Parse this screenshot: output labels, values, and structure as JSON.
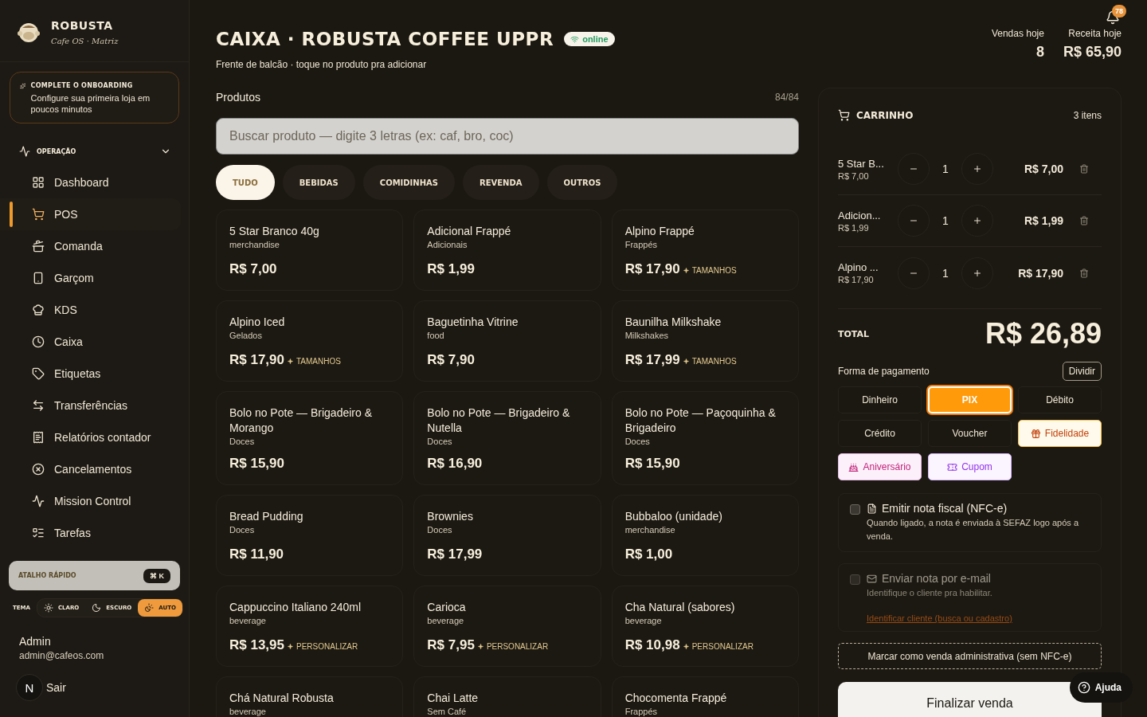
{
  "brand": {
    "name": "ROBUSTA",
    "subtitle": "Cafe OS · Matriz"
  },
  "onboarding": {
    "title": "COMPLETE O ONBOARDING",
    "text": "Configure sua primeira loja em poucos minutos"
  },
  "nav_section": {
    "label": "OPERAÇÃO",
    "expanded": true
  },
  "nav": [
    {
      "label": "Dashboard",
      "selected": false
    },
    {
      "label": "POS",
      "selected": true
    },
    {
      "label": "Comanda",
      "selected": false
    },
    {
      "label": "Garçom",
      "selected": false
    },
    {
      "label": "KDS",
      "selected": false
    },
    {
      "label": "Caixa",
      "selected": false
    },
    {
      "label": "Etiquetas",
      "selected": false
    },
    {
      "label": "Transferências",
      "selected": false
    },
    {
      "label": "Relatórios contador",
      "selected": false
    },
    {
      "label": "Cancelamentos",
      "selected": false
    },
    {
      "label": "Mission Control",
      "selected": false
    },
    {
      "label": "Tarefas",
      "selected": false
    }
  ],
  "quick": {
    "label": "ATALHO RÁPIDO",
    "shortcut": "⌘ K"
  },
  "theme": {
    "label": "TEMA",
    "options": [
      {
        "label": "CLARO",
        "selected": false
      },
      {
        "label": "ESCURO",
        "selected": false
      },
      {
        "label": "AUTO",
        "selected": true
      }
    ]
  },
  "user": {
    "name": "Admin",
    "email": "admin@cafeos.com",
    "logout": "Sair",
    "avatar": "N"
  },
  "header": {
    "title": "CAIXA · ROBUSTA COFFEE UPPR",
    "status": "online",
    "subtitle": "Frente de balcão · toque no produto pra adicionar"
  },
  "stats": [
    {
      "label": "Vendas hoje",
      "value": "8"
    },
    {
      "label": "Receita hoje",
      "value": "R$ 65,90"
    }
  ],
  "notifications": {
    "count": "78"
  },
  "products_header": {
    "title": "Produtos",
    "count": "84/84"
  },
  "search": {
    "placeholder": "Buscar produto — digite 3 letras (ex: caf, bro, coc)"
  },
  "categories": [
    {
      "label": "TUDO",
      "selected": true
    },
    {
      "label": "BEBIDAS",
      "selected": false
    },
    {
      "label": "COMIDINHAS",
      "selected": false
    },
    {
      "label": "REVENDA",
      "selected": false
    },
    {
      "label": "OUTROS",
      "selected": false
    }
  ],
  "products": [
    {
      "name": "5 Star Branco 40g",
      "category": "merchandise",
      "price": "R$ 7,00"
    },
    {
      "name": "Adicional Frappé",
      "category": "Adicionais",
      "price": "R$ 1,99"
    },
    {
      "name": "Alpino Frappé",
      "category": "Frappés",
      "price": "R$ 17,90",
      "extra": "TAMANHOS"
    },
    {
      "name": "Alpino Iced",
      "category": "Gelados",
      "price": "R$ 17,90",
      "extra": "TAMANHOS"
    },
    {
      "name": "Baguetinha Vitrine",
      "category": "food",
      "price": "R$ 7,90"
    },
    {
      "name": "Baunilha Milkshake",
      "category": "Milkshakes",
      "price": "R$ 17,99",
      "extra": "TAMANHOS"
    },
    {
      "name": "Bolo no Pote — Brigadeiro & Morango",
      "category": "Doces",
      "price": "R$ 15,90"
    },
    {
      "name": "Bolo no Pote — Brigadeiro & Nutella",
      "category": "Doces",
      "price": "R$ 16,90"
    },
    {
      "name": "Bolo no Pote — Paçoquinha & Brigadeiro",
      "category": "Doces",
      "price": "R$ 15,90"
    },
    {
      "name": "Bread Pudding",
      "category": "Doces",
      "price": "R$ 11,90"
    },
    {
      "name": "Brownies",
      "category": "Doces",
      "price": "R$ 17,99"
    },
    {
      "name": "Bubbaloo (unidade)",
      "category": "merchandise",
      "price": "R$ 1,00"
    },
    {
      "name": "Cappuccino Italiano 240ml",
      "category": "beverage",
      "price": "R$ 13,95",
      "extra": "PERSONALIZAR"
    },
    {
      "name": "Carioca",
      "category": "beverage",
      "price": "R$ 7,95",
      "extra": "PERSONALIZAR"
    },
    {
      "name": "Cha Natural (sabores)",
      "category": "beverage",
      "price": "R$ 10,98",
      "extra": "PERSONALIZAR"
    },
    {
      "name": "Chá Natural Robusta",
      "category": "beverage"
    },
    {
      "name": "Chai Latte",
      "category": "Sem Café"
    },
    {
      "name": "Chocomenta Frappé",
      "category": "Frappés"
    }
  ],
  "cart": {
    "title": "CARRINHO",
    "count": "3 itens",
    "items": [
      {
        "name": "5 Star B...",
        "unit_price": "R$ 7,00",
        "qty": "1",
        "total": "R$ 7,00"
      },
      {
        "name": "Adicion...",
        "unit_price": "R$ 1,99",
        "qty": "1",
        "total": "R$ 1,99"
      },
      {
        "name": "Alpino ...",
        "unit_price": "R$ 17,90",
        "qty": "1",
        "total": "R$ 17,90"
      }
    ],
    "total_label": "TOTAL",
    "total": "R$ 26,89",
    "payment_label": "Forma de pagamento",
    "split": "Dividir",
    "payments": [
      {
        "label": "Dinheiro",
        "kind": "plain",
        "selected": false
      },
      {
        "label": "PIX",
        "kind": "plain",
        "selected": true
      },
      {
        "label": "Débito",
        "kind": "plain",
        "selected": false
      },
      {
        "label": "Crédito",
        "kind": "plain",
        "selected": false
      },
      {
        "label": "Voucher",
        "kind": "plain",
        "selected": false
      },
      {
        "label": "Fidelidade",
        "kind": "loyalty",
        "selected": false
      },
      {
        "label": "Aniversário",
        "kind": "birthday",
        "selected": false
      },
      {
        "label": "Cupom",
        "kind": "coupon",
        "selected": false
      }
    ],
    "options": [
      {
        "kind": "document",
        "title": "Emitir nota fiscal (NFC-e)",
        "text": "Quando ligado, a nota é enviada à SEFAZ logo após a venda.",
        "checked": false,
        "disabled": false
      },
      {
        "kind": "mail",
        "title": "Enviar nota por e-mail",
        "text": "Identifique o cliente pra habilitar.",
        "checked": false,
        "disabled": true,
        "link": "Identificar cliente (busca ou cadastro)"
      }
    ],
    "admin_sale": "Marcar como venda administrativa (sem NFC-e)",
    "finish": "Finalizar venda"
  },
  "help": "Ajuda"
}
